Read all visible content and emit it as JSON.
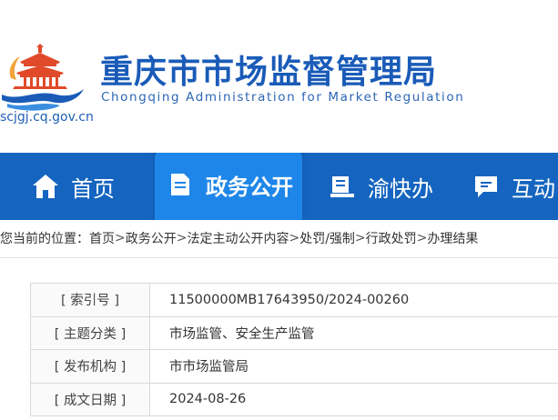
{
  "site": {
    "title": "重庆市市场监督管理局",
    "subtitle": "Chongqing Administration for Market Regulation",
    "domain": "scjgj.cq.gov.cn"
  },
  "nav": {
    "items": [
      {
        "label": "首页",
        "icon": "home-icon"
      },
      {
        "label": "政务公开",
        "icon": "document-icon",
        "active": true
      },
      {
        "label": "渝快办",
        "icon": "service-desk-icon"
      },
      {
        "label": "互动",
        "icon": "chat-icon"
      }
    ]
  },
  "breadcrumb": {
    "prefix": "您当前的位置：",
    "items": [
      "首页",
      "政务公开",
      "法定主动公开内容",
      "处罚/强制",
      "行政处罚",
      "办理结果"
    ],
    "separator": ">"
  },
  "info": {
    "rows": [
      {
        "label": "[ 索引号 ]",
        "value": "11500000MB17643950/2024-00260"
      },
      {
        "label": "[ 主题分类 ]",
        "value": "市场监管、安全生产监管"
      },
      {
        "label": "[ 发布机构 ]",
        "value": "市市场监管局"
      },
      {
        "label": "[ 成文日期 ]",
        "value": "2024-08-26"
      }
    ]
  },
  "colors": {
    "nav_bg": "#1565c0",
    "nav_active": "#1e86e8",
    "title_blue": "#1a5bb8",
    "logo_red": "#e04a2a"
  }
}
